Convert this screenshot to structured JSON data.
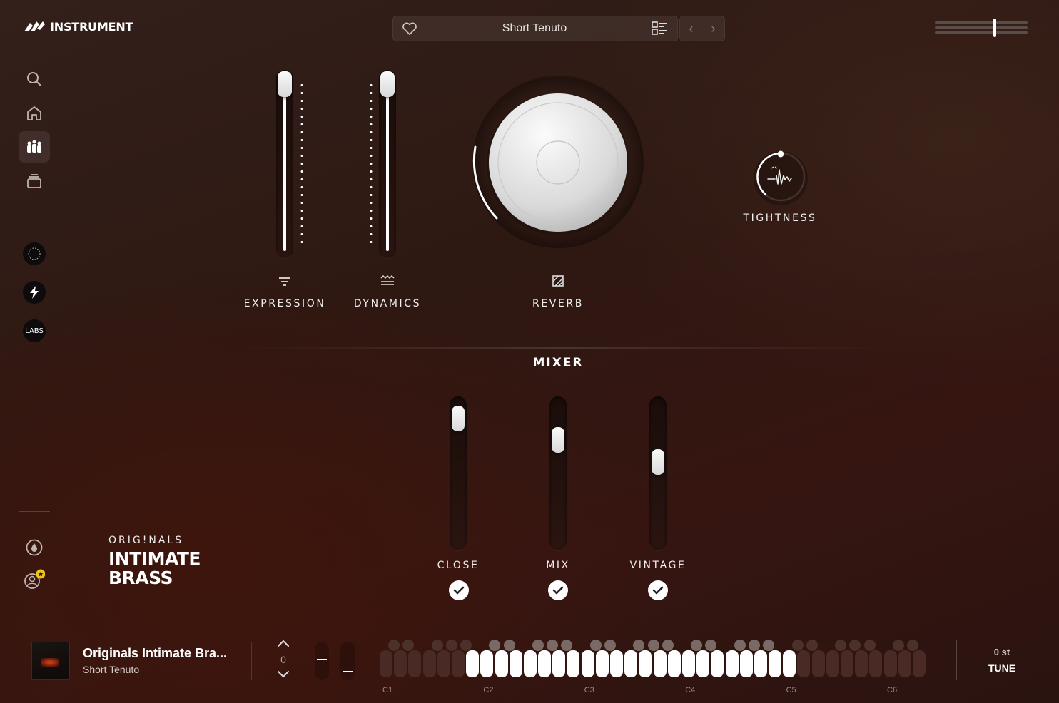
{
  "header": {
    "brand": "INSTRUMENT",
    "preset": "Short Tenuto",
    "master_volume": 0.65
  },
  "sidebar": {
    "items": [
      {
        "name": "search"
      },
      {
        "name": "home"
      },
      {
        "name": "instruments",
        "active": true
      },
      {
        "name": "library"
      }
    ],
    "badges": [
      "originals",
      "spitfire",
      "LABS"
    ]
  },
  "controls": {
    "expression": {
      "label": "EXPRESSION",
      "value": 1.0
    },
    "dynamics": {
      "label": "DYNAMICS",
      "value": 1.0
    },
    "reverb": {
      "label": "REVERB"
    },
    "tightness": {
      "label": "TIGHTNESS"
    }
  },
  "mixer": {
    "title": "MIXER",
    "channels": [
      {
        "label": "CLOSE",
        "value": 0.95,
        "enabled": true
      },
      {
        "label": "MIX",
        "value": 0.78,
        "enabled": true
      },
      {
        "label": "VINTAGE",
        "value": 0.6,
        "enabled": true
      }
    ]
  },
  "product": {
    "line": "ORIG!NALS",
    "name1": "INTIMATE",
    "name2": "BRASS"
  },
  "footer": {
    "title": "Originals Intimate Bra...",
    "subtitle": "Short Tenuto",
    "transpose": "0",
    "octaves": [
      "C1",
      "C2",
      "C3",
      "C4",
      "C5",
      "C6"
    ],
    "tune_value": "0 st",
    "tune_label": "TUNE"
  }
}
